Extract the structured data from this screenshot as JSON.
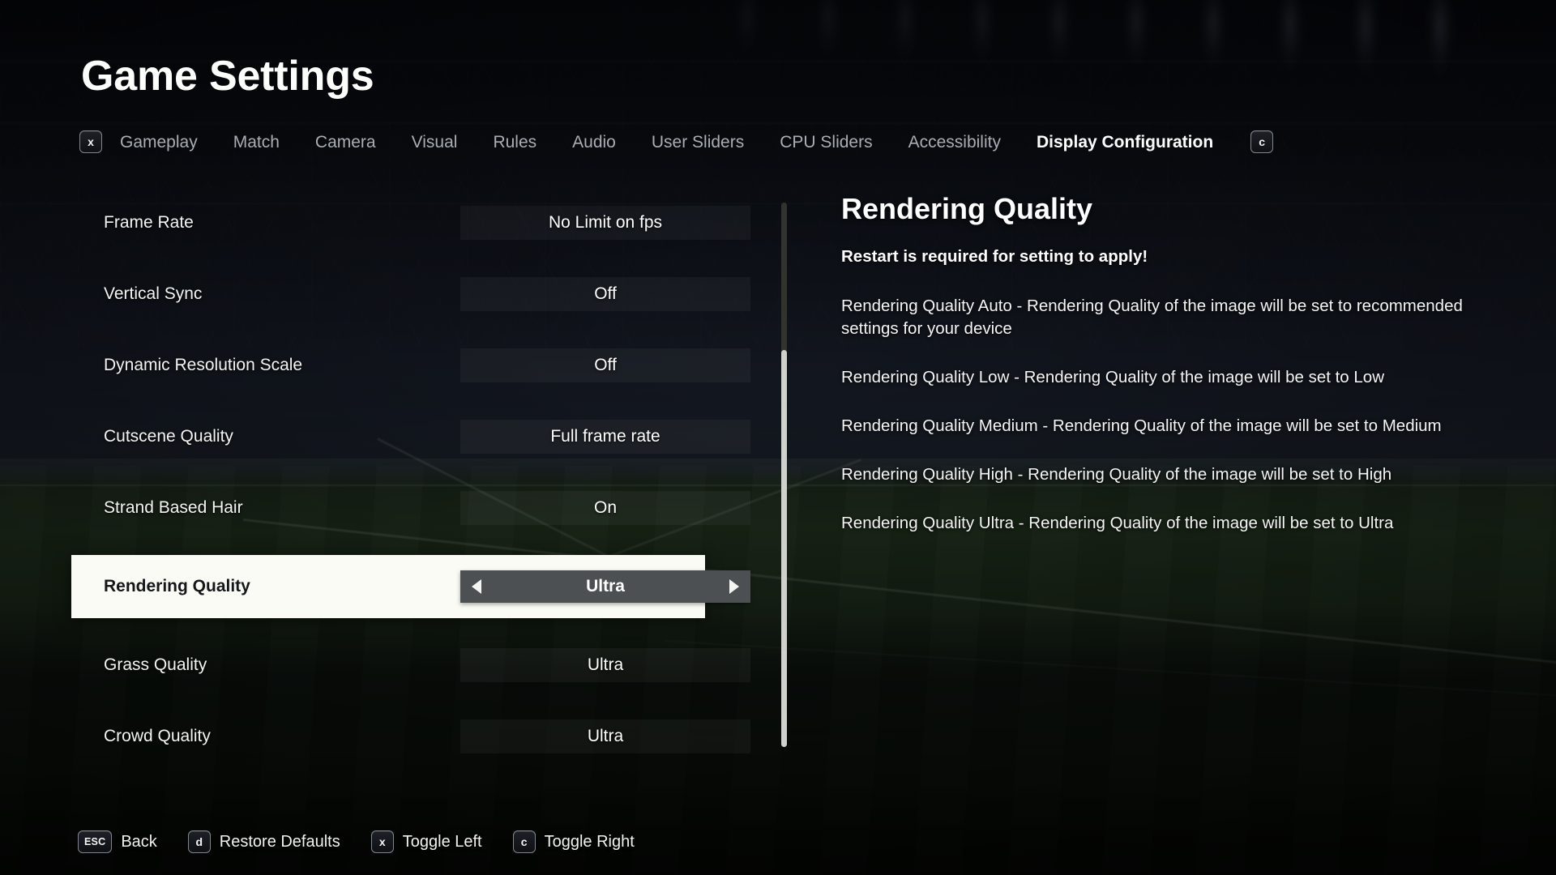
{
  "header": {
    "title": "Game Settings",
    "left_key": "x",
    "right_key": "c"
  },
  "tabs": [
    {
      "label": "Gameplay",
      "active": false
    },
    {
      "label": "Match",
      "active": false
    },
    {
      "label": "Camera",
      "active": false
    },
    {
      "label": "Visual",
      "active": false
    },
    {
      "label": "Rules",
      "active": false
    },
    {
      "label": "Audio",
      "active": false
    },
    {
      "label": "User Sliders",
      "active": false
    },
    {
      "label": "CPU Sliders",
      "active": false
    },
    {
      "label": "Accessibility",
      "active": false
    },
    {
      "label": "Display Configuration",
      "active": true
    }
  ],
  "settings": [
    {
      "label": "Frame Rate",
      "value": "No Limit on fps",
      "selected": false
    },
    {
      "label": "Vertical Sync",
      "value": "Off",
      "selected": false
    },
    {
      "label": "Dynamic Resolution Scale",
      "value": "Off",
      "selected": false
    },
    {
      "label": "Cutscene Quality",
      "value": "Full frame rate",
      "selected": false
    },
    {
      "label": "Strand Based Hair",
      "value": "On",
      "selected": false
    },
    {
      "label": "Rendering Quality",
      "value": "Ultra",
      "selected": true
    },
    {
      "label": "Grass Quality",
      "value": "Ultra",
      "selected": false
    },
    {
      "label": "Crowd Quality",
      "value": "Ultra",
      "selected": false
    }
  ],
  "info": {
    "title": "Rendering Quality",
    "warning": "Restart is required for setting to apply!",
    "items": [
      "Rendering Quality Auto - Rendering Quality of the image will be set to recommended settings for your device",
      "Rendering Quality Low - Rendering Quality of the image will be set to Low",
      "Rendering Quality Medium - Rendering Quality of the image will be set to Medium",
      "Rendering Quality High - Rendering Quality of the image will be set to High",
      "Rendering Quality Ultra - Rendering Quality of the image will be set to Ultra"
    ]
  },
  "footer": [
    {
      "key": "ESC",
      "label": "Back"
    },
    {
      "key": "d",
      "label": "Restore Defaults"
    },
    {
      "key": "x",
      "label": "Toggle Left"
    },
    {
      "key": "c",
      "label": "Toggle Right"
    }
  ],
  "stepper": {
    "left_arrow_icon": "triangle-left-icon",
    "right_arrow_icon": "triangle-right-icon"
  },
  "colors": {
    "selected_row_bg": "#fbfbf5",
    "selected_row_text": "#14161a",
    "stepper_bg": "#4c5052",
    "text_primary": "#ffffff",
    "text_muted": "#a9aeb5",
    "scrollbar_thumb": "#cfd2cc",
    "scrollbar_track": "#30332e"
  },
  "scroll": {
    "thumb_position_percent": 27,
    "thumb_size_percent": 73
  }
}
